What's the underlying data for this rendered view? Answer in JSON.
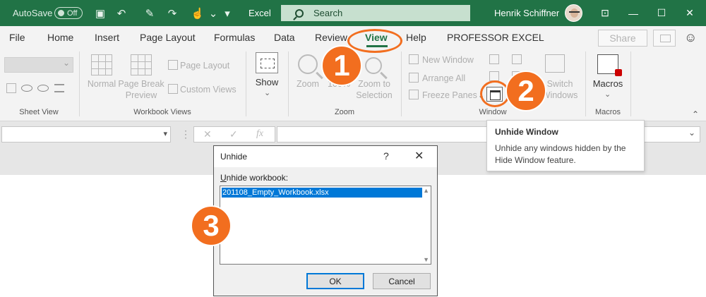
{
  "titlebar": {
    "autosave_label": "AutoSave",
    "autosave_state": "Off",
    "app_name": "Excel",
    "search_placeholder": "Search",
    "user_name": "Henrik Schiffner",
    "bg_color": "#217346"
  },
  "tabs": [
    {
      "label": "File"
    },
    {
      "label": "Home"
    },
    {
      "label": "Insert"
    },
    {
      "label": "Page Layout"
    },
    {
      "label": "Formulas"
    },
    {
      "label": "Data"
    },
    {
      "label": "Review"
    },
    {
      "label": "View",
      "active": true
    },
    {
      "label": "Help"
    },
    {
      "label": "PROFESSOR EXCEL"
    }
  ],
  "share_label": "Share",
  "ribbon": {
    "sheet_view": {
      "group_label": "Sheet View"
    },
    "workbook_views": {
      "group_label": "Workbook Views",
      "normal": "Normal",
      "page_break_1": "Page Break",
      "page_break_2": "Preview",
      "page_layout": "Page Layout",
      "custom_views": "Custom Views"
    },
    "show": {
      "label": "Show"
    },
    "zoom": {
      "group_label": "Zoom",
      "zoom": "Zoom",
      "hundred": "100%",
      "zoom_sel_1": "Zoom to",
      "zoom_sel_2": "Selection"
    },
    "window": {
      "group_label": "Window",
      "new_window": "New Window",
      "arrange_all": "Arrange All",
      "freeze_panes": "Freeze Panes",
      "switch_1": "Switch",
      "switch_2": "Windows"
    },
    "macros": {
      "group_label": "Macros",
      "label": "Macros"
    }
  },
  "formula_bar": {
    "fx": "fx"
  },
  "tooltip": {
    "title": "Unhide Window",
    "body": "Unhide any windows hidden by the Hide Window feature."
  },
  "dialog": {
    "title": "Unhide",
    "help": "?",
    "label_first": "U",
    "label_rest": "nhide workbook:",
    "items": [
      "201108_Empty_Workbook.xlsx"
    ],
    "ok": "OK",
    "cancel": "Cancel"
  },
  "callouts": [
    "1",
    "2",
    "3"
  ],
  "accent_color": "#f26e1f"
}
